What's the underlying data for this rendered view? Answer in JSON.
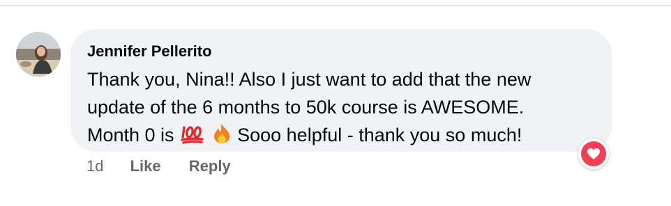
{
  "comment": {
    "author": "Jennifer Pellerito",
    "lines": [
      "Thank you, Nina!! Also I just want to add that the new",
      "update of the 6 months to 50k course is AWESOME."
    ],
    "line3_prefix": "Month 0 is",
    "line3_suffix": "Sooo helpful - thank you so much!",
    "emojis": [
      "100-emoji-icon",
      "fire-emoji-icon"
    ],
    "reaction": "heart-icon",
    "reaction_color": "#f33e58"
  },
  "actions": {
    "time": "1d",
    "like": "Like",
    "reply": "Reply"
  },
  "colors": {
    "bubble": "#f0f2f5",
    "secondary_text": "#65676b",
    "divider": "#e4e6eb"
  }
}
